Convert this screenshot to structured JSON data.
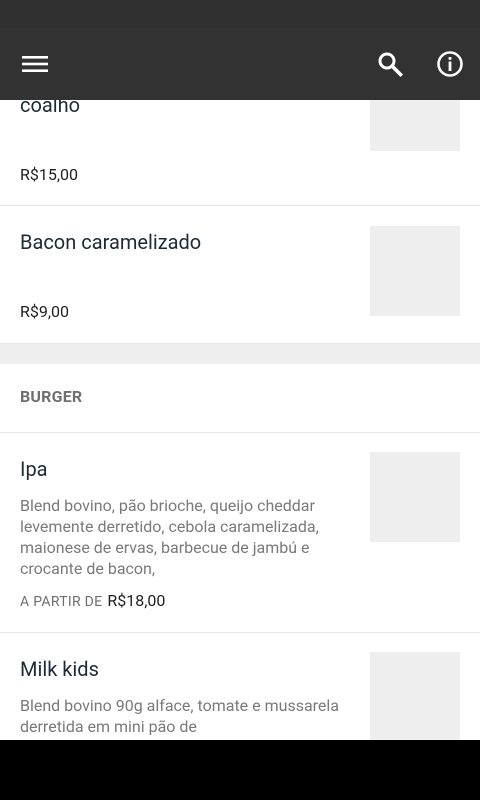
{
  "toolbar": {
    "menu_icon": "menu-icon",
    "search_icon": "search-icon",
    "info_icon": "info-icon",
    "background": "#323232"
  },
  "items_before": [
    {
      "name": "coalho",
      "price": "R$15,00"
    },
    {
      "name": "Bacon caramelizado",
      "price": "R$9,00"
    }
  ],
  "section": {
    "title": "BURGER"
  },
  "items_burger": [
    {
      "name": "Ipa",
      "description": "Blend bovino, pão brioche, queijo cheddar levemente derretido, cebola caramelizada, maionese de ervas, barbecue de jambú e crocante de bacon,",
      "price_prefix": "A PARTIR DE",
      "price": "R$18,00"
    },
    {
      "name": "Milk kids",
      "description": "Blend bovino 90g alface, tomate e mussarela derretida em mini pão de"
    }
  ]
}
